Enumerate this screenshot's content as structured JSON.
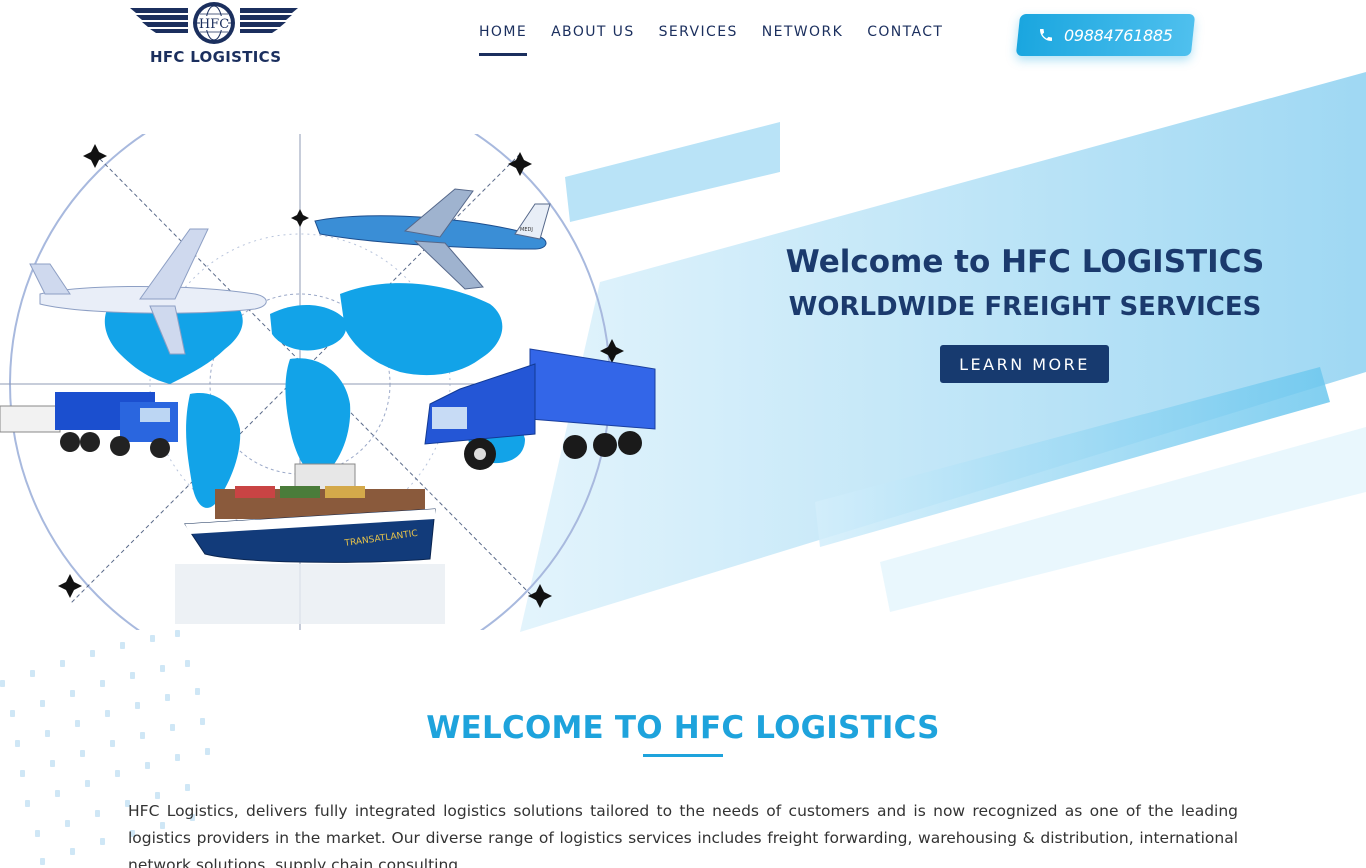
{
  "header": {
    "logo_badge": "HFC",
    "logo_text": "HFC LOGISTICS",
    "nav": [
      {
        "label": "HOME",
        "active": true
      },
      {
        "label": "ABOUT US",
        "active": false
      },
      {
        "label": "SERVICES",
        "active": false
      },
      {
        "label": "NETWORK",
        "active": false
      },
      {
        "label": "CONTACT",
        "active": false
      }
    ],
    "phone": {
      "icon": "phone-icon",
      "number": "09884761885"
    }
  },
  "hero": {
    "title": "Welcome to HFC LOGISTICS",
    "subtitle": "WORLDWIDE FREIGHT SERVICES",
    "cta_label": "LEARN MORE",
    "art_labels": {
      "plane_tail": "MEDJ",
      "ship_name": "TRANSATLANTIC"
    }
  },
  "welcome": {
    "title": "WELCOME TO HFC LOGISTICS",
    "body": "HFC Logistics, delivers fully integrated logistics solutions tailored to the needs of customers and is now recognized as one of the leading logistics providers in the market. Our diverse range of logistics services includes freight forwarding, warehousing & distribution, international network solutions, supply chain consulting."
  },
  "colors": {
    "navy": "#1b2f5e",
    "accent_blue": "#1ea3dc",
    "button_navy": "#173a6f",
    "light_blue": "#a9dcf4"
  }
}
